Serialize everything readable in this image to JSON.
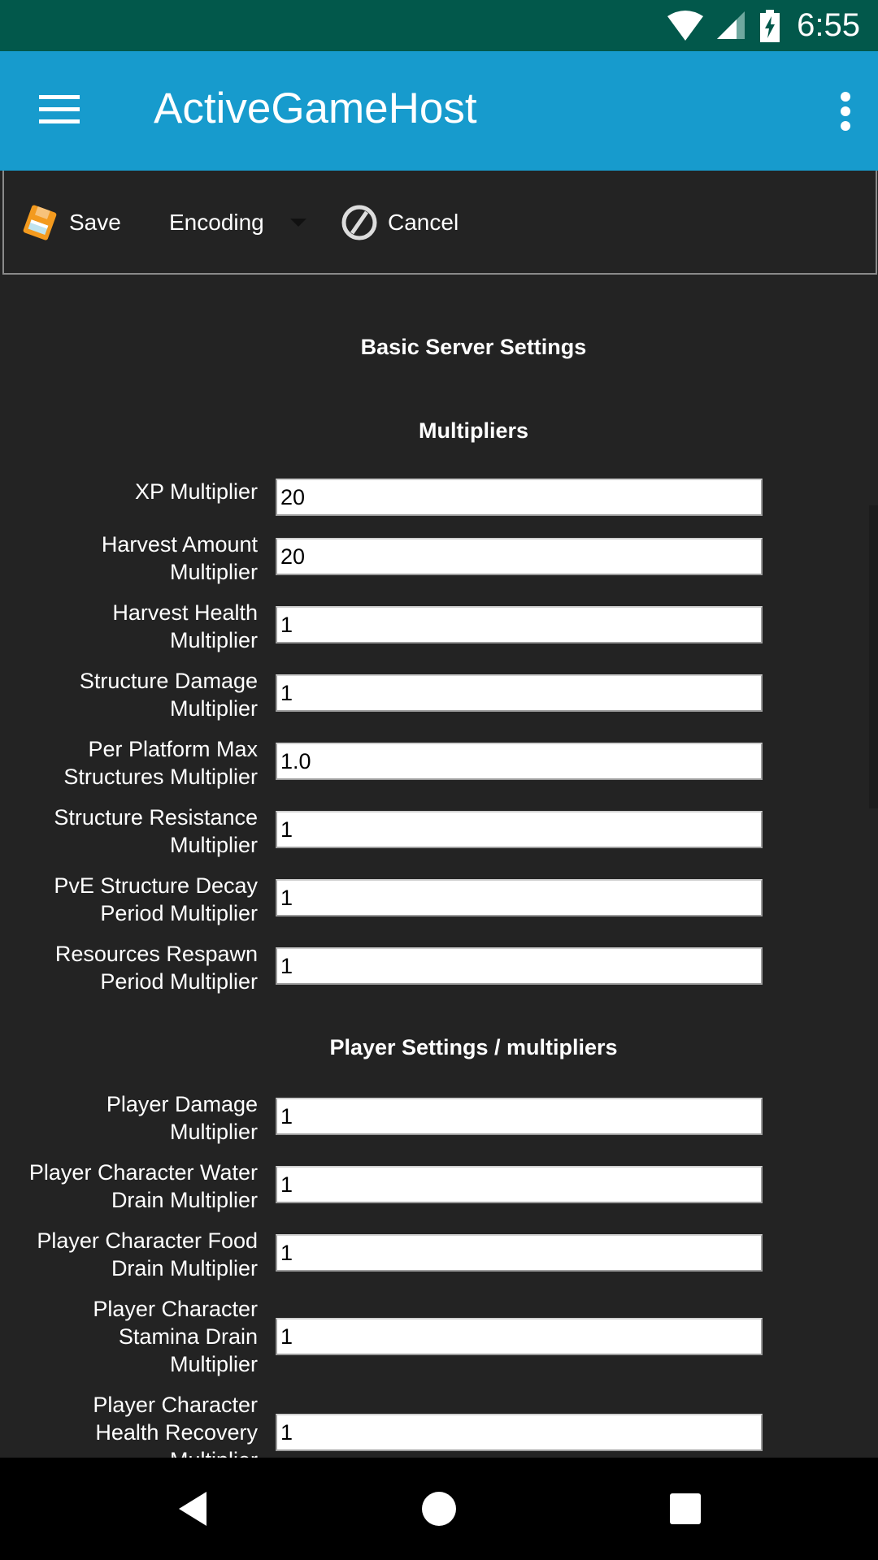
{
  "status_bar": {
    "time": "6:55",
    "icons": [
      "wifi-icon",
      "cell-signal-icon",
      "battery-charging-icon"
    ]
  },
  "app_bar": {
    "title": "ActiveGameHost",
    "left_icon": "hamburger-menu-icon",
    "right_icon": "overflow-menu-icon"
  },
  "toolbar": {
    "save_label": "Save",
    "encoding_label": "Encoding",
    "cancel_label": "Cancel"
  },
  "sections": {
    "basic_title": "Basic Server Settings",
    "multipliers_title": "Multipliers",
    "player_title": "Player Settings / multipliers"
  },
  "multipliers": [
    {
      "label": "XP Multiplier",
      "value": "20"
    },
    {
      "label": "Harvest Amount Multiplier",
      "value": "20"
    },
    {
      "label": "Harvest Health Multiplier",
      "value": "1"
    },
    {
      "label": "Structure Damage Multiplier",
      "value": "1"
    },
    {
      "label": "Per Platform Max Structures Multiplier",
      "value": "1.0"
    },
    {
      "label": "Structure Resistance Multiplier",
      "value": "1"
    },
    {
      "label": "PvE Structure Decay Period Multiplier",
      "value": "1"
    },
    {
      "label": "Resources Respawn Period Multiplier",
      "value": "1"
    }
  ],
  "player_settings": [
    {
      "label": "Player Damage Multiplier",
      "value": "1"
    },
    {
      "label": "Player Character Water Drain Multiplier",
      "value": "1"
    },
    {
      "label": "Player Character Food Drain Multiplier",
      "value": "1"
    },
    {
      "label": "Player Character Stamina Drain Multiplier",
      "value": "1"
    },
    {
      "label": "Player Character Health Recovery Multiplier",
      "value": "1"
    }
  ],
  "nav_bar": {
    "buttons": [
      "back-icon",
      "home-icon",
      "recents-icon"
    ]
  },
  "colors": {
    "status_bar": "#02584b",
    "app_bar": "#179bcd",
    "background": "#232323"
  }
}
